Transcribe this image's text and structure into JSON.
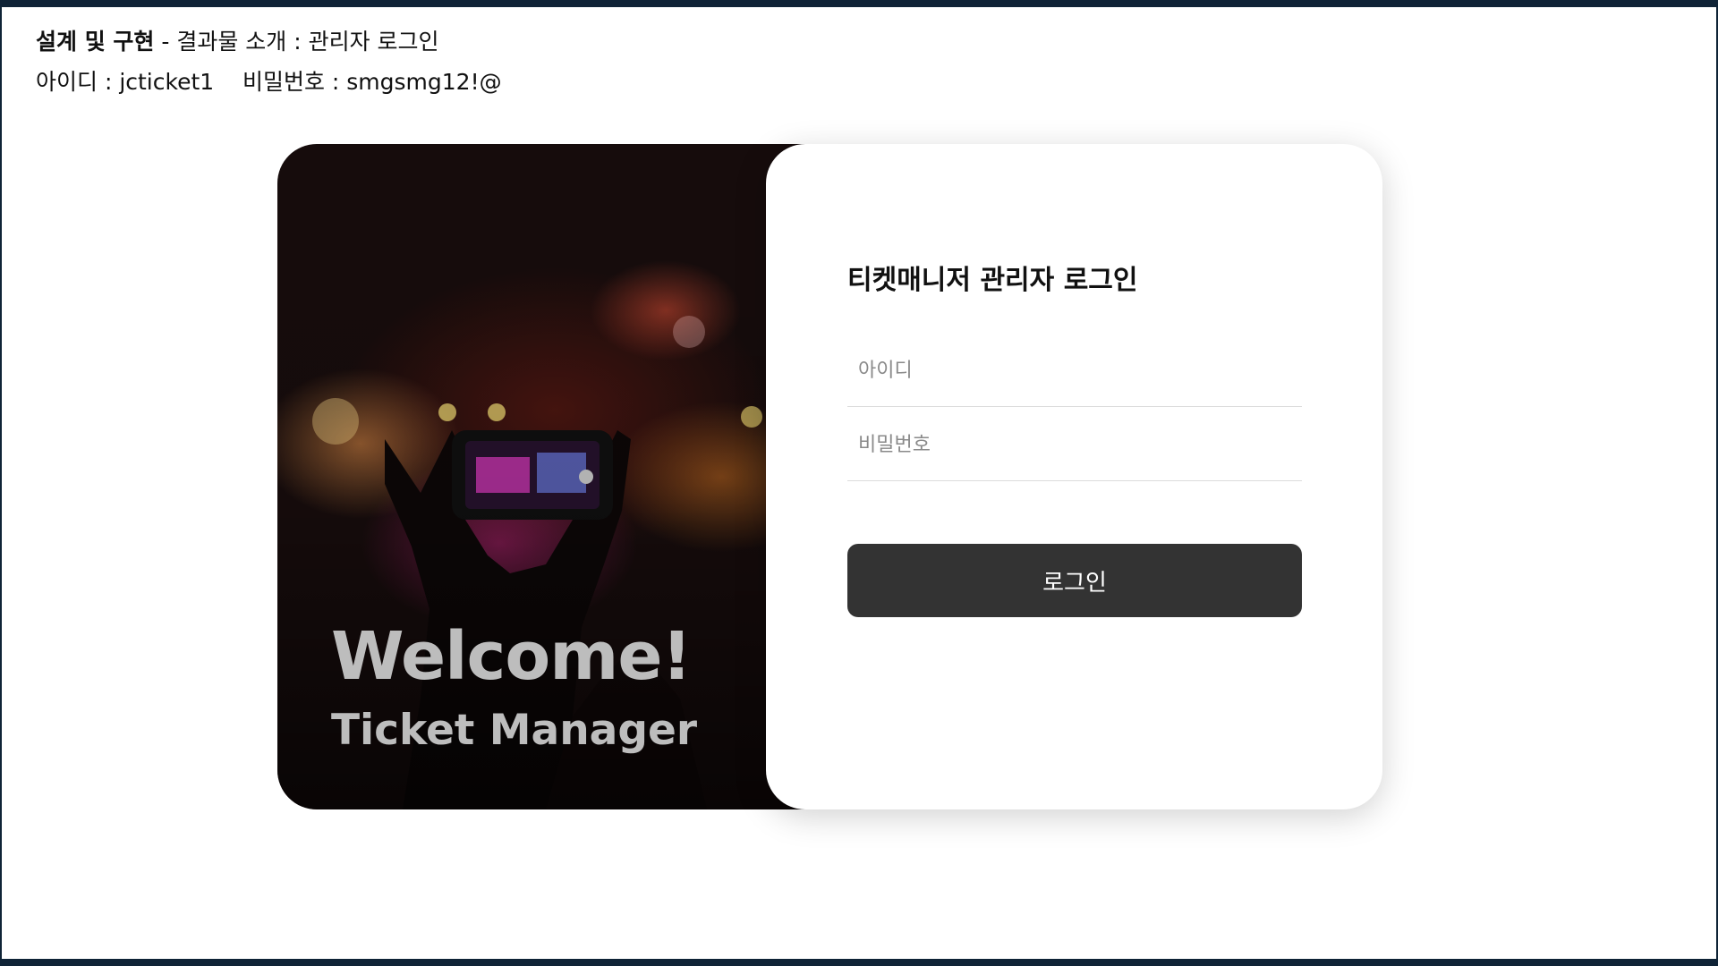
{
  "intro": {
    "title_bold": "설계 및 구현",
    "title_rest": " - 결과물 소개 : 관리자 로그인",
    "credentials": "아이디 : jcticket1    비밀번호 : smgsmg12!@"
  },
  "hero": {
    "welcome": "Welcome!",
    "subtitle": "Ticket Manager"
  },
  "login": {
    "title": "티켓매니저 관리자 로그인",
    "id_placeholder": "아이디",
    "password_placeholder": "비밀번호",
    "button_label": "로그인"
  }
}
